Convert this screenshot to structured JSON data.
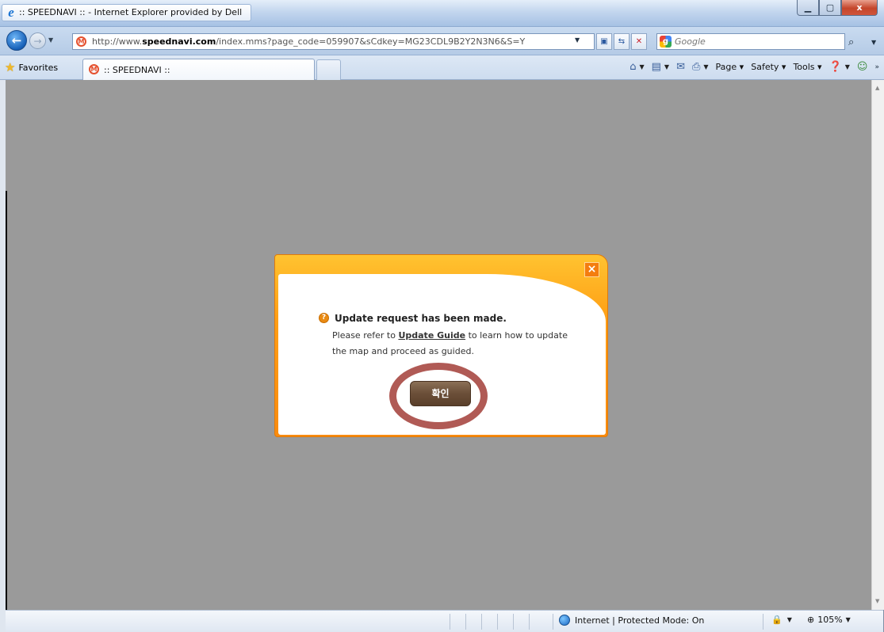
{
  "window": {
    "title": ":: SPEEDNAVI :: - Internet Explorer provided by Dell",
    "controls": {
      "minimize": "▁",
      "maximize": "▢",
      "close": "x"
    }
  },
  "address_bar": {
    "url_prefix": "http://www.",
    "url_domain": "speednavi.com",
    "url_suffix": "/index.mms?page_code=059907&sCdkey=MG23CDL9B2Y2N3N6&S=Y",
    "search_placeholder": "Google"
  },
  "favorites_bar": {
    "favorites_label": "Favorites",
    "tab_title": ":: SPEEDNAVI ::"
  },
  "command_bar": {
    "page": "Page",
    "safety": "Safety",
    "tools": "Tools"
  },
  "dialog": {
    "heading": "Update request has been made.",
    "body_before": "Please refer to ",
    "link_text": "Update Guide",
    "body_after": " to learn how to update the map and proceed as guided.",
    "confirm_label": "확인",
    "close_label": "×"
  },
  "status_bar": {
    "zone_text": "Internet | Protected Mode: On",
    "zoom": "105%"
  },
  "icons": {
    "ie": "e",
    "star": "★",
    "site": "M",
    "info": "?"
  },
  "colors": {
    "dialog_orange": "#ff9f15",
    "confirm_brown": "#6b4f38",
    "highlight_ring": "#b05a55",
    "page_gray": "#9a9a9a"
  }
}
